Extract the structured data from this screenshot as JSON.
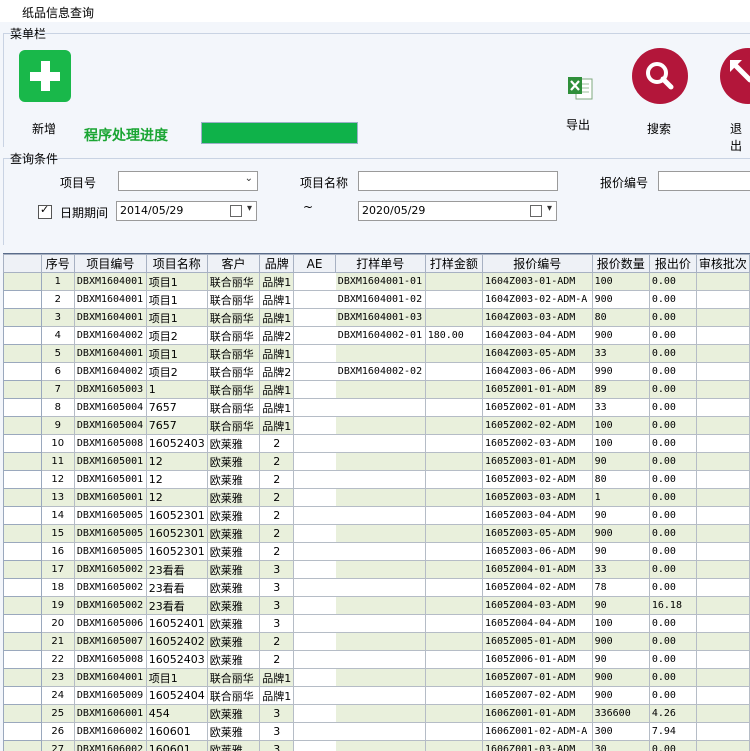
{
  "window": {
    "title": "纸品信息查询"
  },
  "menu": {
    "group_label": "菜单栏",
    "add_label": "新增",
    "progress_label": "程序处理进度",
    "progress_value": 1.0,
    "export_label": "导出",
    "search_label": "搜索",
    "exit_label": "退出"
  },
  "query": {
    "group_label": "查询条件",
    "project_no_label": "项目号",
    "project_no_value": "",
    "project_name_label": "项目名称",
    "project_name_value": "",
    "quote_no_label": "报价编号",
    "quote_no_value": "",
    "date_checked": true,
    "date_label": "日期期间",
    "date_from": "2014/05/29",
    "date_sep": "~",
    "date_to": "2020/05/29"
  },
  "grid": {
    "headers": [
      "序号",
      "项目编号",
      "项目名称",
      "客户",
      "品牌",
      "AE",
      "打样单号",
      "打样金额",
      "报价编号",
      "报价数量",
      "报出价",
      "审核批次"
    ],
    "rows": [
      [
        "1",
        "DBXM1604001",
        "项目1",
        "联合丽华",
        "品牌1",
        "",
        "DBXM1604001-01",
        "",
        "1604Z003-01-ADM",
        "100",
        "0.00",
        ""
      ],
      [
        "2",
        "DBXM1604001",
        "项目1",
        "联合丽华",
        "品牌1",
        "",
        "DBXM1604001-02",
        "",
        "1604Z003-02-ADM-A",
        "900",
        "0.00",
        ""
      ],
      [
        "3",
        "DBXM1604001",
        "项目1",
        "联合丽华",
        "品牌1",
        "",
        "DBXM1604001-03",
        "",
        "1604Z003-03-ADM",
        "80",
        "0.00",
        ""
      ],
      [
        "4",
        "DBXM1604002",
        "项目2",
        "联合丽华",
        "品牌2",
        "",
        "DBXM1604002-01",
        "180.00",
        "1604Z003-04-ADM",
        "900",
        "0.00",
        ""
      ],
      [
        "5",
        "DBXM1604001",
        "项目1",
        "联合丽华",
        "品牌1",
        "",
        "",
        "",
        "1604Z003-05-ADM",
        "33",
        "0.00",
        ""
      ],
      [
        "6",
        "DBXM1604002",
        "项目2",
        "联合丽华",
        "品牌2",
        "",
        "DBXM1604002-02",
        "",
        "1604Z003-06-ADM",
        "990",
        "0.00",
        ""
      ],
      [
        "7",
        "DBXM1605003",
        "1",
        "联合丽华",
        "品牌1",
        "",
        "",
        "",
        "1605Z001-01-ADM",
        "89",
        "0.00",
        ""
      ],
      [
        "8",
        "DBXM1605004",
        "7657",
        "联合丽华",
        "品牌1",
        "",
        "",
        "",
        "1605Z002-01-ADM",
        "33",
        "0.00",
        ""
      ],
      [
        "9",
        "DBXM1605004",
        "7657",
        "联合丽华",
        "品牌1",
        "",
        "",
        "",
        "1605Z002-02-ADM",
        "100",
        "0.00",
        ""
      ],
      [
        "10",
        "DBXM1605008",
        "16052403",
        "欧莱雅",
        "2",
        "",
        "",
        "",
        "1605Z002-03-ADM",
        "100",
        "0.00",
        ""
      ],
      [
        "11",
        "DBXM1605001",
        "12",
        "欧莱雅",
        "2",
        "",
        "",
        "",
        "1605Z003-01-ADM",
        "90",
        "0.00",
        ""
      ],
      [
        "12",
        "DBXM1605001",
        "12",
        "欧莱雅",
        "2",
        "",
        "",
        "",
        "1605Z003-02-ADM",
        "80",
        "0.00",
        ""
      ],
      [
        "13",
        "DBXM1605001",
        "12",
        "欧莱雅",
        "2",
        "",
        "",
        "",
        "1605Z003-03-ADM",
        "1",
        "0.00",
        ""
      ],
      [
        "14",
        "DBXM1605005",
        "16052301",
        "欧莱雅",
        "2",
        "",
        "",
        "",
        "1605Z003-04-ADM",
        "90",
        "0.00",
        ""
      ],
      [
        "15",
        "DBXM1605005",
        "16052301",
        "欧莱雅",
        "2",
        "",
        "",
        "",
        "1605Z003-05-ADM",
        "900",
        "0.00",
        ""
      ],
      [
        "16",
        "DBXM1605005",
        "16052301",
        "欧莱雅",
        "2",
        "",
        "",
        "",
        "1605Z003-06-ADM",
        "90",
        "0.00",
        ""
      ],
      [
        "17",
        "DBXM1605002",
        "23看看",
        "欧莱雅",
        "3",
        "",
        "",
        "",
        "1605Z004-01-ADM",
        "33",
        "0.00",
        ""
      ],
      [
        "18",
        "DBXM1605002",
        "23看看",
        "欧莱雅",
        "3",
        "",
        "",
        "",
        "1605Z004-02-ADM",
        "78",
        "0.00",
        ""
      ],
      [
        "19",
        "DBXM1605002",
        "23看看",
        "欧莱雅",
        "3",
        "",
        "",
        "",
        "1605Z004-03-ADM",
        "90",
        "16.18",
        ""
      ],
      [
        "20",
        "DBXM1605006",
        "16052401",
        "欧莱雅",
        "3",
        "",
        "",
        "",
        "1605Z004-04-ADM",
        "100",
        "0.00",
        ""
      ],
      [
        "21",
        "DBXM1605007",
        "16052402",
        "欧莱雅",
        "2",
        "",
        "",
        "",
        "1605Z005-01-ADM",
        "900",
        "0.00",
        ""
      ],
      [
        "22",
        "DBXM1605008",
        "16052403",
        "欧莱雅",
        "2",
        "",
        "",
        "",
        "1605Z006-01-ADM",
        "90",
        "0.00",
        ""
      ],
      [
        "23",
        "DBXM1604001",
        "项目1",
        "联合丽华",
        "品牌1",
        "",
        "",
        "",
        "1605Z007-01-ADM",
        "900",
        "0.00",
        ""
      ],
      [
        "24",
        "DBXM1605009",
        "16052404",
        "联合丽华",
        "品牌1",
        "",
        "",
        "",
        "1605Z007-02-ADM",
        "900",
        "0.00",
        ""
      ],
      [
        "25",
        "DBXM1606001",
        "454",
        "欧莱雅",
        "3",
        "",
        "",
        "",
        "1606Z001-01-ADM",
        "336600",
        "4.26",
        ""
      ],
      [
        "26",
        "DBXM1606002",
        "160601",
        "欧莱雅",
        "3",
        "",
        "",
        "",
        "1606Z001-02-ADM-A",
        "300",
        "7.94",
        ""
      ],
      [
        "27",
        "DBXM1606002",
        "160601",
        "欧莱雅",
        "3",
        "",
        "",
        "",
        "1606Z001-03-ADM",
        "30",
        "0.00",
        ""
      ]
    ]
  },
  "colors": {
    "accent_green": "#19b84a",
    "progress_green": "#0fb24a",
    "action_red": "#b3163a",
    "row_alt": "#e9f0dc"
  }
}
